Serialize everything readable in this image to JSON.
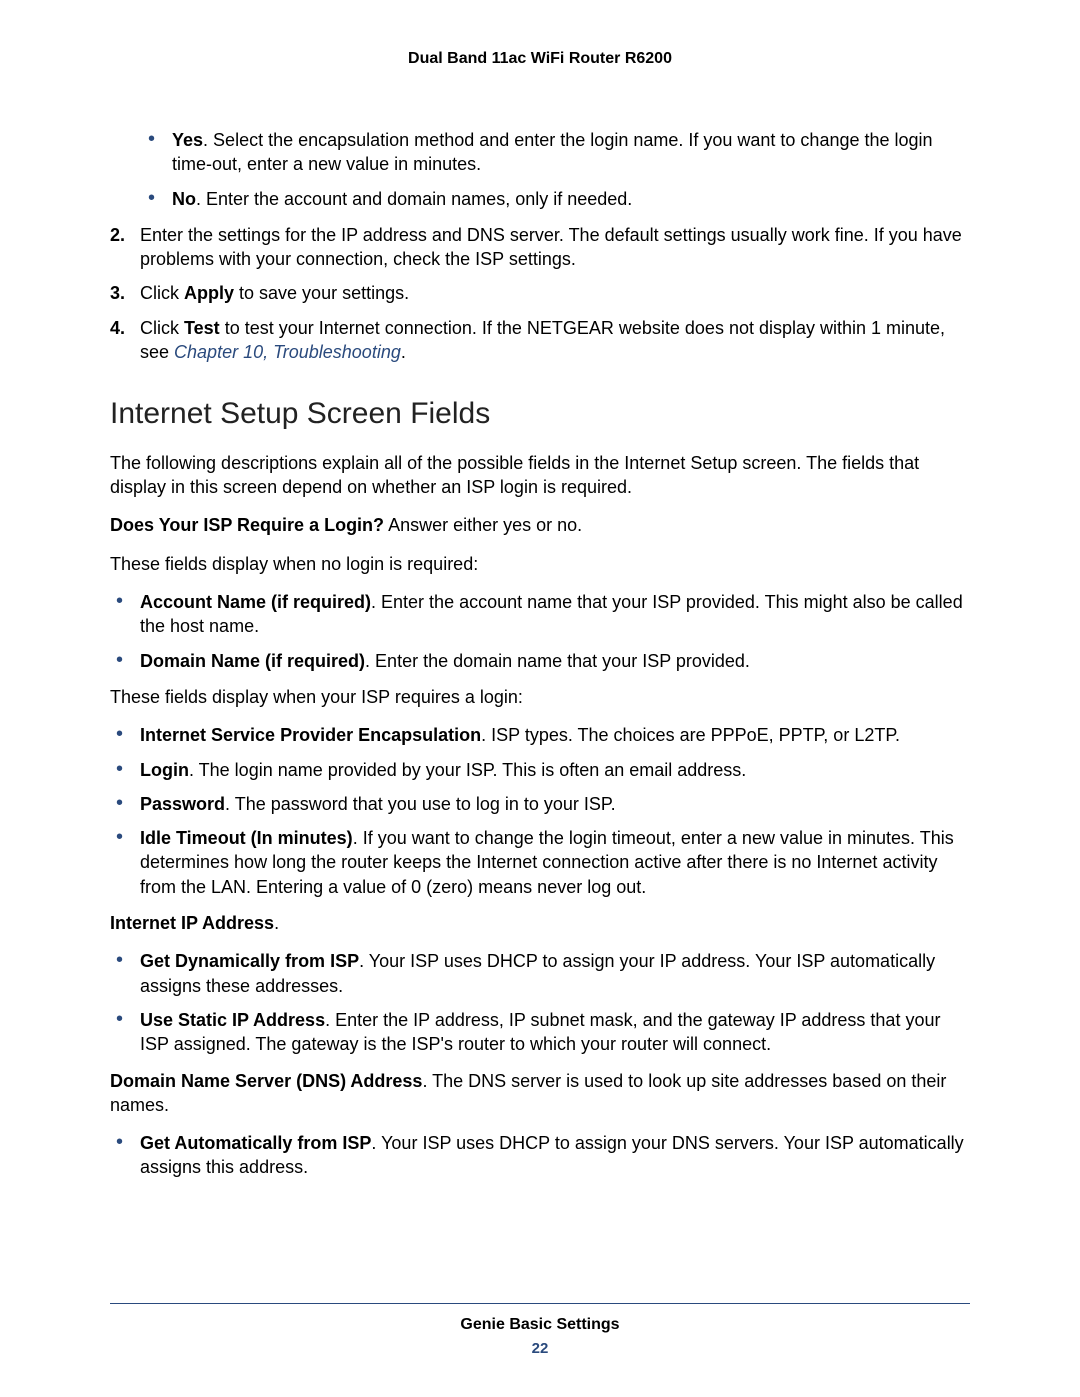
{
  "header": "Dual Band 11ac WiFi Router R6200",
  "top_bullets": [
    {
      "lead": "Yes",
      "text": ". Select the encapsulation method and enter the login name. If you want to change the login time-out, enter a new value in minutes."
    },
    {
      "lead": "No",
      "text": ". Enter the account and domain names, only if needed."
    }
  ],
  "numbered": [
    {
      "n": "2.",
      "pre": "",
      "text": "Enter the settings for the IP address and DNS server. The default settings usually work fine. If you have problems with your connection, check the ISP settings."
    },
    {
      "n": "3.",
      "pre": "Click ",
      "bold1": "Apply",
      "mid": " to save your settings.",
      "tail": ""
    },
    {
      "n": "4.",
      "pre": "Click ",
      "bold1": "Test",
      "mid": " to test your Internet connection. If the NETGEAR website does not display within 1 minute, see ",
      "link": "Chapter 10, Troubleshooting",
      "tail": "."
    }
  ],
  "section_title": "Internet Setup Screen Fields",
  "intro": "The following descriptions explain all of the possible fields in the Internet Setup screen. The fields that display in this screen depend on whether an ISP login is required.",
  "q_bold": "Does Your ISP Require a Login?",
  "q_rest": " Answer either yes or no.",
  "no_login_intro": "These fields display when no login is required:",
  "no_login_items": [
    {
      "lead": "Account Name (if required)",
      "text": ". Enter the account name that your ISP provided. This might also be called the host name."
    },
    {
      "lead": "Domain Name (if required)",
      "text": ". Enter the domain name that your ISP provided."
    }
  ],
  "login_intro": "These fields display when your ISP requires a login:",
  "login_items": [
    {
      "lead": "Internet Service Provider Encapsulation",
      "text": ". ISP types. The choices are PPPoE, PPTP, or L2TP."
    },
    {
      "lead": "Login",
      "text": ". The login name provided by your ISP. This is often an email address."
    },
    {
      "lead": "Password",
      "text": ". The password that you use to log in to your ISP."
    },
    {
      "lead": "Idle Timeout (In minutes)",
      "text": ". If you want to change the login timeout, enter a new value in minutes. This determines how long the router keeps the Internet connection active after there is no Internet activity from the LAN. Entering a value of 0 (zero) means never log out."
    }
  ],
  "ip_heading": "Internet IP Address",
  "ip_items": [
    {
      "lead": "Get Dynamically from ISP",
      "text": ". Your ISP uses DHCP to assign your IP address. Your ISP automatically assigns these addresses."
    },
    {
      "lead": "Use Static IP Address",
      "text": ". Enter the IP address, IP subnet mask, and the gateway IP address that your ISP assigned. The gateway is the ISP's router to which your router will connect."
    }
  ],
  "dns_bold": "Domain Name Server (DNS) Address",
  "dns_rest": ". The DNS server is used to look up site addresses based on their names.",
  "dns_items": [
    {
      "lead": "Get Automatically from ISP",
      "text": ". Your ISP uses DHCP to assign your DNS servers. Your ISP automatically assigns this address."
    }
  ],
  "footer_title": "Genie Basic Settings",
  "footer_page": "22"
}
